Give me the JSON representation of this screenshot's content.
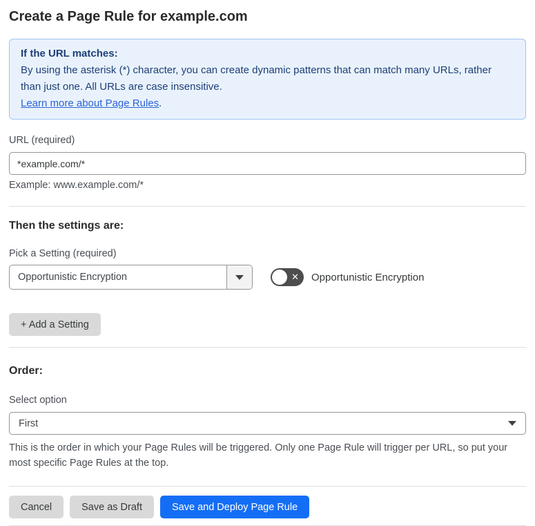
{
  "page": {
    "title": "Create a Page Rule for example.com"
  },
  "info_box": {
    "heading": "If the URL matches:",
    "body": "By using the asterisk (*) character, you can create dynamic patterns that can match many URLs, rather than just one. All URLs are case insensitive.",
    "link_label": "Learn more about Page Rules",
    "link_suffix": "."
  },
  "url_field": {
    "label": "URL (required)",
    "value": "*example.com/*",
    "helper": "Example: www.example.com/*"
  },
  "settings_section": {
    "heading": "Then the settings are:",
    "pick_label": "Pick a Setting (required)",
    "selected_setting": "Opportunistic Encryption",
    "toggle_state": "off",
    "toggle_label": "Opportunistic Encryption",
    "add_button_label": "+ Add a Setting"
  },
  "order_section": {
    "heading": "Order:",
    "select_label": "Select option",
    "selected_option": "First",
    "helper": "This is the order in which your Page Rules will be triggered. Only one Page Rule will trigger per URL, so put your most specific Page Rules at the top."
  },
  "footer": {
    "cancel_label": "Cancel",
    "save_draft_label": "Save as Draft",
    "save_deploy_label": "Save and Deploy Page Rule"
  },
  "icons": {
    "toggle_off": "✕"
  },
  "colors": {
    "accent_blue": "#146ef5",
    "info_bg": "#e9f2fc",
    "info_border": "#9fc4f0",
    "info_text": "#1d3f77",
    "link_blue": "#2c63d6",
    "toggle_off_bg": "#4d4d4d",
    "button_gray": "#d9d9d9"
  }
}
